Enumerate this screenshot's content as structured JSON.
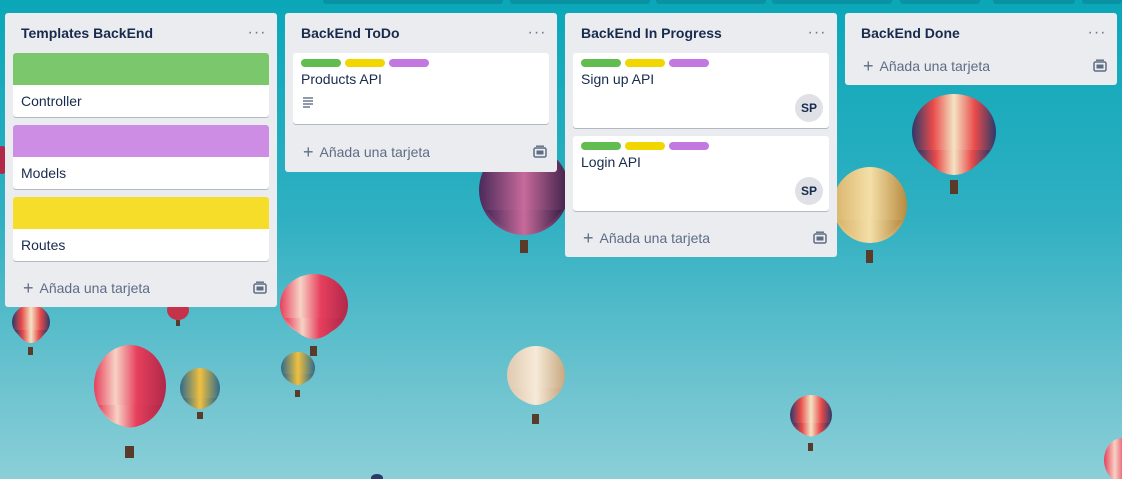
{
  "lists": [
    {
      "title": "Templates BackEnd",
      "menu": "···",
      "add_label": "Añada una tarjeta",
      "cards": [
        {
          "title": "Controller",
          "cover": "#7bc86c"
        },
        {
          "title": "Models",
          "cover": "#cd8de5"
        },
        {
          "title": "Routes",
          "cover": "#f5dd29"
        }
      ]
    },
    {
      "title": "BackEnd ToDo",
      "menu": "···",
      "add_label": "Añada una tarjeta",
      "cards": [
        {
          "title": "Products API",
          "labels": [
            "#61bd4f",
            "#f2d600",
            "#c377e0"
          ],
          "has_description": true
        }
      ]
    },
    {
      "title": "BackEnd In Progress",
      "menu": "···",
      "add_label": "Añada una tarjeta",
      "cards": [
        {
          "title": "Sign up API",
          "labels": [
            "#61bd4f",
            "#f2d600",
            "#c377e0"
          ],
          "member": "SP"
        },
        {
          "title": "Login API",
          "labels": [
            "#61bd4f",
            "#f2d600",
            "#c377e0"
          ],
          "member": "SP"
        }
      ]
    },
    {
      "title": "BackEnd Done",
      "menu": "···",
      "add_label": "Añada una tarjeta",
      "cards": []
    }
  ],
  "icons": {
    "menu": "ellipsis-icon",
    "add": "plus-icon",
    "template": "card-template-icon",
    "description": "description-icon"
  }
}
